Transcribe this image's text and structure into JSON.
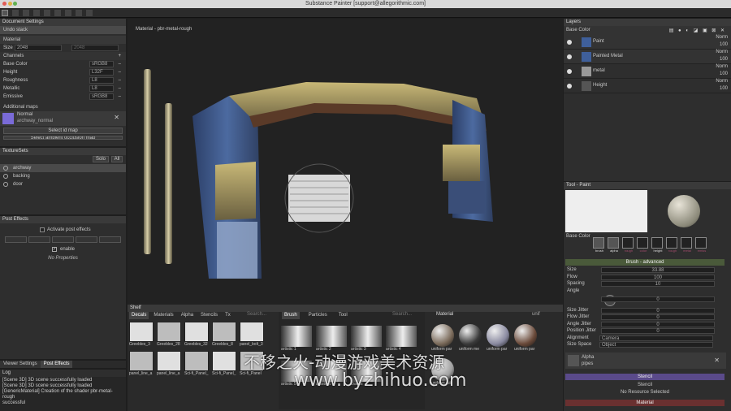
{
  "window": {
    "title": "Substance Painter [support@allegorithmic.com]"
  },
  "toolbar": {
    "icons": [
      "paint-brush-icon",
      "eraser-icon",
      "projection-icon",
      "geometry-mask-icon",
      "smudge-icon",
      "clone-icon",
      "material-picker-icon",
      "polygon-fill-icon",
      "camera-icon"
    ]
  },
  "doc": {
    "title": "Document Settings",
    "undo": "Undo stack",
    "material_label": "Material",
    "size_label": "Size",
    "size_value": "2048",
    "size_value2": "2048",
    "channels_label": "Channels",
    "channels": [
      {
        "name": "Base Color",
        "fmt": "sRGB8"
      },
      {
        "name": "Height",
        "fmt": "L32F"
      },
      {
        "name": "Roughness",
        "fmt": "L8"
      },
      {
        "name": "Metallic",
        "fmt": "L8"
      },
      {
        "name": "Emissive",
        "fmt": "sRGB8"
      }
    ],
    "additional": "Additional maps",
    "normal_label": "Normal",
    "normal_map": "archway_normal",
    "select_id": "Select id map",
    "select_ao": "Select ambient occlusion map"
  },
  "texturesets": {
    "title": "TextureSets",
    "solo": "Solo",
    "all": "All",
    "items": [
      "archway",
      "backing",
      "door"
    ]
  },
  "posteffects": {
    "title": "Post Effects",
    "activate": "Activate post effects",
    "enable": "enable",
    "noprops": "No Properties"
  },
  "bottomtabs": {
    "viewer": "Viewer Settings",
    "post": "Post Effects"
  },
  "log": {
    "title": "Log",
    "lines": [
      "[Scene 3D] 3D scene successfully loaded",
      "[Scene 3D] 3D scene successfully loaded",
      "[GenericMaterial] Creation of the shader pbr-metal-rough",
      "successful"
    ]
  },
  "viewport": {
    "label": "Material - pbr-metal-rough"
  },
  "shelf": {
    "title": "Shelf",
    "tabs": [
      "Decals",
      "Materials",
      "Alpha",
      "Stencils",
      "Tx"
    ],
    "search": "Search...",
    "items": [
      "Greebles_3",
      "Greebles_28",
      "Greebles_32",
      "Greebles_8",
      "panel_bolt_3",
      "panel_line_a",
      "panel_line_a",
      "Sci-fi_Panel_",
      "Sci-fi_Panel_",
      "Sci-fi_Panel"
    ],
    "brush_tabs": [
      "Brush",
      "Particles",
      "Tool"
    ],
    "brush_search": "Search...",
    "brush_items": [
      "artistic 1",
      "artistic 2",
      "artistic 3",
      "artistic 4",
      "artistic 5",
      "artistic 6",
      "cracks"
    ],
    "mat_tab": "Material",
    "mat_extra": "unif",
    "mat_items": [
      "uniform par",
      "uniform me",
      "uniform par",
      "uniform par",
      "uniform rub"
    ]
  },
  "layers": {
    "title": "Layers",
    "channel": "Base Color",
    "items": [
      {
        "name": "Paint",
        "blend": "Norm",
        "opacity": "100"
      },
      {
        "name": "Painted Metal",
        "blend": "Norm",
        "opacity": "100"
      },
      {
        "name": "metal",
        "blend": "Norm",
        "opacity": "100"
      },
      {
        "name": "Height",
        "blend": "Norm",
        "opacity": "100"
      }
    ]
  },
  "tool": {
    "title": "Tool - Paint",
    "base": "Base Color",
    "chips": [
      "brush",
      "alpha",
      "rough",
      "color",
      "height",
      "rough",
      "metal",
      "emiss"
    ],
    "section": "Brush - advanced",
    "size_label": "Size",
    "size_value": "33.88",
    "flow_label": "Flow",
    "flow_value": "100",
    "spacing_label": "Spacing",
    "spacing_value": "10",
    "angle_label": "Angle",
    "angle_value": "0",
    "sj": "Size Jitter",
    "sj_v": "0",
    "fj": "Flow Jitter",
    "fj_v": "0",
    "aj": "Angle Jitter",
    "aj_v": "0",
    "pj": "Position Jitter",
    "pj_v": "0",
    "align": "Alignment",
    "align_v": "Camera",
    "space": "Size Space",
    "space_v": "Object",
    "alpha": "Alpha",
    "alpha_v": "pipes",
    "stencil_hdr": "Stencil",
    "stencil": "Stencil",
    "no_res": "No Resource Selected",
    "mat_hdr": "Material"
  },
  "watermark": {
    "cn": "不移之火-动漫游戏美术资源",
    "url": "www.byzhihuo.com"
  },
  "colors": {
    "accent": "#3f5f9a",
    "stencil": "#5a4a8a",
    "section": "#4a5a3a"
  }
}
